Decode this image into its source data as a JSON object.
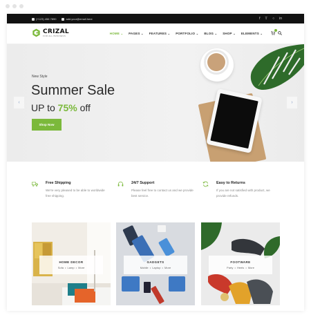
{
  "topbar": {
    "phone": "(+123) 456 7890",
    "email": "add.your@email.here",
    "social": [
      "f",
      "t",
      "ig",
      "in"
    ]
  },
  "brand": {
    "name": "CRIZAL",
    "tagline": "FOR ALL BUSINESS",
    "accent_color": "#7bb93b"
  },
  "nav": {
    "items": [
      {
        "label": "HOME",
        "active": true
      },
      {
        "label": "PAGES",
        "active": false
      },
      {
        "label": "FEATURES",
        "active": false
      },
      {
        "label": "PORTFOLIO",
        "active": false
      },
      {
        "label": "BLOG",
        "active": false
      },
      {
        "label": "SHOP",
        "active": false
      },
      {
        "label": "ELEMENTS",
        "active": false
      }
    ],
    "icons": [
      "cart-icon",
      "search-icon"
    ]
  },
  "hero": {
    "eyebrow": "New Style",
    "title": "Summer Sale",
    "subtitle_prefix": "UP to",
    "subtitle_percent": "75%",
    "subtitle_suffix": "off",
    "button_label": "Shop Now",
    "prev_icon": "chevron-left-icon",
    "next_icon": "chevron-right-icon"
  },
  "features": [
    {
      "title": "Free Shipping",
      "text": "We're very pleased to be able to worldwide free shipping.",
      "icon": "truck-icon"
    },
    {
      "title": "24/7 Support",
      "text": "Please feel free to contact us and we provide best service.",
      "icon": "headset-icon"
    },
    {
      "title": "Easy to Returns",
      "text": "If you are not satisfied with product, we provide refunds.",
      "icon": "refresh-icon"
    }
  ],
  "categories": [
    {
      "title": "HOME DECOR",
      "sub": "Sofa • Lamp • More"
    },
    {
      "title": "GADGETS",
      "sub": "Mobile • Laptop • More"
    },
    {
      "title": "FOOTWARE",
      "sub": "Party • Heels • More"
    }
  ]
}
